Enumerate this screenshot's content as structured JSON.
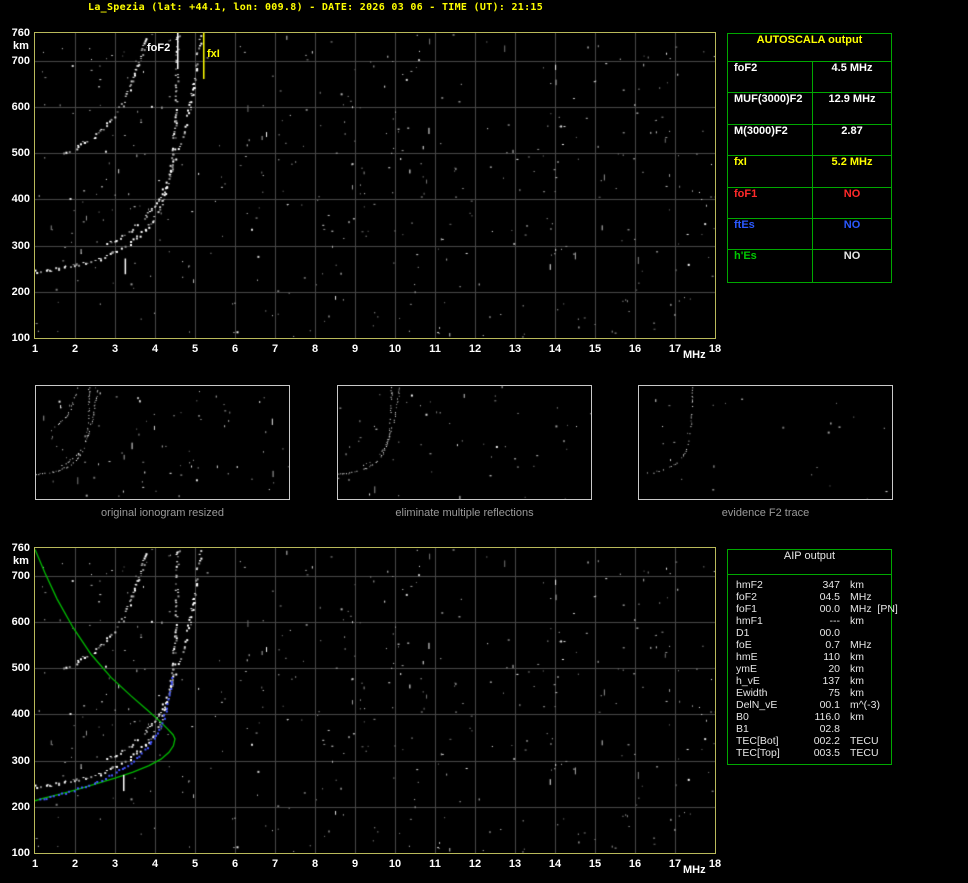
{
  "title": "La_Spezia (lat: +44.1, lon: 009.8) - DATE: 2026 03 06 - TIME (UT): 21:15",
  "colors": {
    "background": "#000000",
    "title": "#ffff00",
    "plot_border": "#b9b95a",
    "grid": "#484848",
    "trace": "#ffffff",
    "profile_green": "#00bb00",
    "scaled_trace_blue": "#4455ff",
    "table_border": "#00a800",
    "autoscala_header": "#ffff00",
    "caption_gray": "#9a9a9a"
  },
  "autoscala": {
    "header": "AUTOSCALA output",
    "rows": [
      {
        "label": "foF2",
        "value": "4.5 MHz",
        "label_color": "#ffffff",
        "value_color": "#ffffff"
      },
      {
        "label": "MUF(3000)F2",
        "value": "12.9 MHz",
        "label_color": "#ffffff",
        "value_color": "#ffffff"
      },
      {
        "label": "M(3000)F2",
        "value": "2.87",
        "label_color": "#ffffff",
        "value_color": "#ffffff"
      },
      {
        "label": "fxI",
        "value": "5.2 MHz",
        "label_color": "#ffff00",
        "value_color": "#ffff00"
      },
      {
        "label": "foF1",
        "value": "NO",
        "label_color": "#ff2a2a",
        "value_color": "#ff2a2a"
      },
      {
        "label": "ftEs",
        "value": "NO",
        "label_color": "#2b59ff",
        "value_color": "#2b59ff"
      },
      {
        "label": "h'Es",
        "value": "NO",
        "label_color": "#00c800",
        "value_color": "#e6e6e6"
      }
    ]
  },
  "aip": {
    "header": "AIP output",
    "rows": [
      {
        "label": "hmF2",
        "value": "347",
        "unit": "km"
      },
      {
        "label": "foF2",
        "value": "04.5",
        "unit": "MHz"
      },
      {
        "label": "foF1",
        "value": "00.0",
        "unit": "MHz  [PN]"
      },
      {
        "label": "hmF1",
        "value": "---",
        "unit": "km"
      },
      {
        "label": "D1",
        "value": "00.0",
        "unit": ""
      },
      {
        "label": "foE",
        "value": "0.7",
        "unit": "MHz"
      },
      {
        "label": "hmE",
        "value": "110",
        "unit": "km"
      },
      {
        "label": "ymE",
        "value": "20",
        "unit": "km"
      },
      {
        "label": "h_vE",
        "value": "137",
        "unit": "km"
      },
      {
        "label": "Ewidth",
        "value": "75",
        "unit": "km"
      },
      {
        "label": "DelN_vE",
        "value": "00.1",
        "unit": "m^(-3)"
      },
      {
        "label": "B0",
        "value": "116.0",
        "unit": "km"
      },
      {
        "label": "B1",
        "value": "02.8",
        "unit": ""
      },
      {
        "label": "TEC[Bot]",
        "value": "002.2",
        "unit": "TECU"
      },
      {
        "label": "TEC[Top]",
        "value": "003.5",
        "unit": "TECU"
      }
    ]
  },
  "thumbnails": [
    {
      "caption": "original ionogram resized",
      "series": [
        "o",
        "x",
        "m"
      ],
      "noise": 80,
      "seed": 11,
      "sparse": false
    },
    {
      "caption": "eliminate multiple reflections",
      "series": [
        "o",
        "x"
      ],
      "noise": 55,
      "seed": 12,
      "sparse": false
    },
    {
      "caption": "evidence F2 trace",
      "series": [
        "o"
      ],
      "noise": 25,
      "seed": 13,
      "sparse": true
    }
  ],
  "chart_data": [
    {
      "id": "top_ionogram",
      "type": "scatter",
      "title": "",
      "xlabel": "MHz",
      "ylabel": "km",
      "xlim": [
        1,
        18
      ],
      "ylim": [
        100,
        760
      ],
      "x_ticks": [
        1,
        2,
        3,
        4,
        5,
        6,
        7,
        8,
        9,
        10,
        11,
        12,
        13,
        14,
        15,
        16,
        17,
        18
      ],
      "y_ticks": [
        760,
        700,
        600,
        500,
        400,
        300,
        200,
        100
      ],
      "x_gridlines": [
        2,
        3,
        4,
        5,
        6,
        7,
        8,
        9,
        10,
        11,
        12,
        13,
        14,
        15,
        16,
        17
      ],
      "y_gridlines": [
        200,
        300,
        400,
        500,
        600,
        700
      ],
      "series": [
        {
          "key": "o",
          "name": "F2 ordinary (o-mode) echo trace",
          "color": "#ffffff",
          "points": [
            [
              1.0,
              245
            ],
            [
              1.4,
              249
            ],
            [
              1.8,
              255
            ],
            [
              2.2,
              262
            ],
            [
              2.6,
              272
            ],
            [
              3.0,
              287
            ],
            [
              3.3,
              302
            ],
            [
              3.6,
              322
            ],
            [
              3.85,
              345
            ],
            [
              4.05,
              372
            ],
            [
              4.2,
              400
            ],
            [
              4.3,
              430
            ],
            [
              4.38,
              465
            ],
            [
              4.44,
              505
            ],
            [
              4.48,
              550
            ],
            [
              4.51,
              600
            ],
            [
              4.53,
              655
            ],
            [
              4.55,
              760
            ]
          ]
        },
        {
          "key": "x",
          "name": "F2 extraordinary (x-mode) echo trace",
          "color": "#ffffff",
          "points": [
            [
              2.7,
              300
            ],
            [
              3.0,
              312
            ],
            [
              3.3,
              328
            ],
            [
              3.6,
              348
            ],
            [
              3.85,
              372
            ],
            [
              4.05,
              398
            ],
            [
              4.25,
              430
            ],
            [
              4.42,
              465
            ],
            [
              4.58,
              505
            ],
            [
              4.72,
              550
            ],
            [
              4.85,
              600
            ],
            [
              4.95,
              655
            ],
            [
              5.05,
              705
            ],
            [
              5.12,
              760
            ]
          ]
        },
        {
          "key": "m",
          "name": "second-hop multiple reflection trace",
          "color": "#ffffff",
          "points": [
            [
              1.6,
              498
            ],
            [
              2.0,
              512
            ],
            [
              2.4,
              532
            ],
            [
              2.75,
              558
            ],
            [
              3.05,
              590
            ],
            [
              3.3,
              630
            ],
            [
              3.5,
              675
            ],
            [
              3.68,
              725
            ],
            [
              3.78,
              760
            ]
          ]
        }
      ],
      "markers": {
        "foF2_line": {
          "label": "foF2",
          "freq": 4.55,
          "color": "#ffffff",
          "len": 36
        },
        "fxI_line": {
          "label": "fxI",
          "freq": 5.2,
          "color": "#ffff00",
          "len": 46
        },
        "tick": {
          "freq": 3.24,
          "h_top": 272,
          "h_bottom": 238
        }
      },
      "noise": {
        "count": 430,
        "seed": 7
      }
    },
    {
      "id": "bottom_ionogram",
      "type": "scatter",
      "title": "",
      "xlabel": "MHz",
      "ylabel": "km",
      "xlim": [
        1,
        18
      ],
      "ylim": [
        100,
        760
      ],
      "x_ticks": [
        1,
        2,
        3,
        4,
        5,
        6,
        7,
        8,
        9,
        10,
        11,
        12,
        13,
        14,
        15,
        16,
        17,
        18
      ],
      "y_ticks": [
        760,
        700,
        600,
        500,
        400,
        300,
        200,
        100
      ],
      "x_gridlines": [
        2,
        3,
        4,
        5,
        6,
        7,
        8,
        9,
        10,
        11,
        12,
        13,
        14,
        15,
        16,
        17
      ],
      "y_gridlines": [
        200,
        300,
        400,
        500,
        600,
        700
      ],
      "base_series_keys": [
        "o",
        "x",
        "m"
      ],
      "extra_series": [
        {
          "key": "profile",
          "name": "AIP electron density profile",
          "type": "line",
          "color": "#00bb00",
          "points": [
            [
              1.0,
              757
            ],
            [
              1.25,
              706
            ],
            [
              1.55,
              650
            ],
            [
              1.95,
              588
            ],
            [
              2.4,
              530
            ],
            [
              2.9,
              480
            ],
            [
              3.4,
              440
            ],
            [
              3.8,
              410
            ],
            [
              4.1,
              387
            ],
            [
              4.32,
              368
            ],
            [
              4.45,
              356
            ],
            [
              4.5,
              347
            ],
            [
              4.46,
              332
            ],
            [
              4.35,
              318
            ],
            [
              4.15,
              303
            ],
            [
              3.85,
              289
            ],
            [
              3.45,
              275
            ],
            [
              3.0,
              262
            ],
            [
              2.5,
              249
            ],
            [
              2.0,
              236
            ],
            [
              1.55,
              226
            ],
            [
              1.2,
              218
            ],
            [
              1.0,
              213
            ]
          ]
        },
        {
          "key": "scaled",
          "name": "autoscaled trace points",
          "type": "dots",
          "color": "#4455ff",
          "points": [
            [
              1.1,
              216
            ],
            [
              1.45,
              224
            ],
            [
              1.85,
              234
            ],
            [
              2.25,
              246
            ],
            [
              2.65,
              260
            ],
            [
              3.0,
              276
            ],
            [
              3.3,
              292
            ],
            [
              3.6,
              312
            ],
            [
              3.85,
              336
            ],
            [
              4.05,
              362
            ],
            [
              4.2,
              392
            ],
            [
              4.3,
              424
            ],
            [
              4.38,
              458
            ],
            [
              4.44,
              490
            ]
          ]
        }
      ],
      "markers": {
        "tick": {
          "freq": 3.2,
          "h_top": 269,
          "h_bottom": 234
        }
      },
      "noise": {
        "count": 430,
        "seed": 7
      }
    }
  ]
}
